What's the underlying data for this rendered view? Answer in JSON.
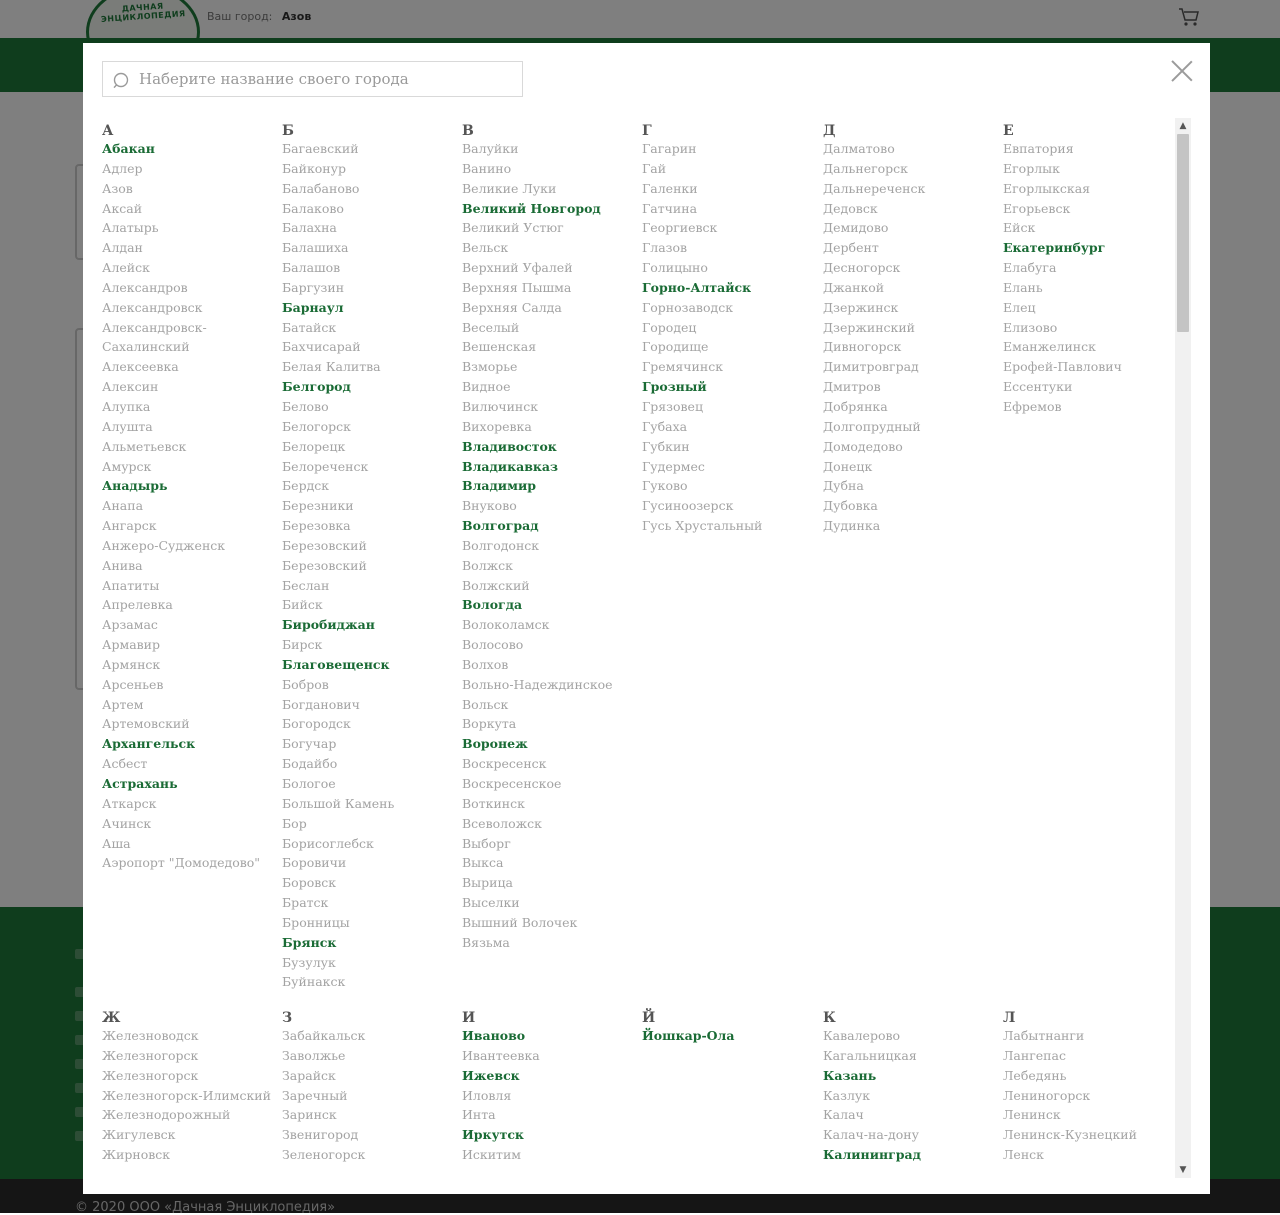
{
  "header": {
    "logo_text": "ДАЧНАЯ ЭНЦИКЛОПЕДИЯ",
    "city_label": "Ваш город:",
    "city_value": "Азов"
  },
  "footer": {
    "copyright": "© 2020 ООО «Дачная Энциклопедия»"
  },
  "modal": {
    "search_placeholder": "Наберите название своего города",
    "search_value": ""
  },
  "colors": {
    "brand_green": "#1f7a3a",
    "major_city": "#1a6b35",
    "city": "#a3a3a3"
  },
  "groups": [
    {
      "letter": "А",
      "cities": [
        {
          "name": "Абакан",
          "major": true
        },
        {
          "name": "Адлер"
        },
        {
          "name": "Азов"
        },
        {
          "name": "Аксай"
        },
        {
          "name": "Алатырь"
        },
        {
          "name": "Алдан"
        },
        {
          "name": "Алейск"
        },
        {
          "name": "Александров"
        },
        {
          "name": "Александровск"
        },
        {
          "name": "Александровск-"
        },
        {
          "name": "Сахалинский"
        },
        {
          "name": "Алексеевка"
        },
        {
          "name": "Алексин"
        },
        {
          "name": "Алупка"
        },
        {
          "name": "Алушта"
        },
        {
          "name": "Альметьевск"
        },
        {
          "name": "Амурск"
        },
        {
          "name": "Анадырь",
          "major": true
        },
        {
          "name": "Анапа"
        },
        {
          "name": "Ангарск"
        },
        {
          "name": "Анжеро-Судженск"
        },
        {
          "name": "Анива"
        },
        {
          "name": "Апатиты"
        },
        {
          "name": "Апрелевка"
        },
        {
          "name": "Арзамас"
        },
        {
          "name": "Армавир"
        },
        {
          "name": "Армянск"
        },
        {
          "name": "Арсеньев"
        },
        {
          "name": "Артем"
        },
        {
          "name": "Артемовский"
        },
        {
          "name": "Архангельск",
          "major": true
        },
        {
          "name": "Асбест"
        },
        {
          "name": "Астрахань",
          "major": true
        },
        {
          "name": "Аткарск"
        },
        {
          "name": "Ачинск"
        },
        {
          "name": "Аша"
        },
        {
          "name": "Аэропорт \"Домодедово\""
        }
      ]
    },
    {
      "letter": "Б",
      "cities": [
        {
          "name": "Багаевский"
        },
        {
          "name": "Байконур"
        },
        {
          "name": "Балабаново"
        },
        {
          "name": "Балаково"
        },
        {
          "name": "Балахна"
        },
        {
          "name": "Балашиха"
        },
        {
          "name": "Балашов"
        },
        {
          "name": "Баргузин"
        },
        {
          "name": "Барнаул",
          "major": true
        },
        {
          "name": "Батайск"
        },
        {
          "name": "Бахчисарай"
        },
        {
          "name": "Белая Калитва"
        },
        {
          "name": "Белгород",
          "major": true
        },
        {
          "name": "Белово"
        },
        {
          "name": "Белогорск"
        },
        {
          "name": "Белорецк"
        },
        {
          "name": "Белореченск"
        },
        {
          "name": "Бердск"
        },
        {
          "name": "Березники"
        },
        {
          "name": "Березовка"
        },
        {
          "name": "Березовский"
        },
        {
          "name": "Березовский"
        },
        {
          "name": "Беслан"
        },
        {
          "name": "Бийск"
        },
        {
          "name": "Биробиджан",
          "major": true
        },
        {
          "name": "Бирск"
        },
        {
          "name": "Благовещенск",
          "major": true
        },
        {
          "name": "Бобров"
        },
        {
          "name": "Богданович"
        },
        {
          "name": "Богородск"
        },
        {
          "name": "Богучар"
        },
        {
          "name": "Бодайбо"
        },
        {
          "name": "Бологое"
        },
        {
          "name": "Большой Камень"
        },
        {
          "name": "Бор"
        },
        {
          "name": "Борисоглебск"
        },
        {
          "name": "Боровичи"
        },
        {
          "name": "Боровск"
        },
        {
          "name": "Братск"
        },
        {
          "name": "Бронницы"
        },
        {
          "name": "Брянск",
          "major": true
        },
        {
          "name": "Бузулук"
        },
        {
          "name": "Буйнакск"
        }
      ]
    },
    {
      "letter": "В",
      "cities": [
        {
          "name": "Валуйки"
        },
        {
          "name": "Ванино"
        },
        {
          "name": "Великие Луки"
        },
        {
          "name": "Великий Новгород",
          "major": true
        },
        {
          "name": "Великий Устюг"
        },
        {
          "name": "Вельск"
        },
        {
          "name": "Верхний Уфалей"
        },
        {
          "name": "Верхняя Пышма"
        },
        {
          "name": "Верхняя Салда"
        },
        {
          "name": "Веселый"
        },
        {
          "name": "Вешенская"
        },
        {
          "name": "Взморье"
        },
        {
          "name": "Видное"
        },
        {
          "name": "Вилючинск"
        },
        {
          "name": "Вихоревка"
        },
        {
          "name": "Владивосток",
          "major": true
        },
        {
          "name": "Владикавказ",
          "major": true
        },
        {
          "name": "Владимир",
          "major": true
        },
        {
          "name": "Внуково"
        },
        {
          "name": "Волгоград",
          "major": true
        },
        {
          "name": "Волгодонск"
        },
        {
          "name": "Волжск"
        },
        {
          "name": "Волжский"
        },
        {
          "name": "Вологда",
          "major": true
        },
        {
          "name": "Волоколамск"
        },
        {
          "name": "Волосово"
        },
        {
          "name": "Волхов"
        },
        {
          "name": "Вольно-Надеждинское"
        },
        {
          "name": "Вольск"
        },
        {
          "name": "Воркута"
        },
        {
          "name": "Воронеж",
          "major": true
        },
        {
          "name": "Воскресенск"
        },
        {
          "name": "Воскресенское"
        },
        {
          "name": "Воткинск"
        },
        {
          "name": "Всеволожск"
        },
        {
          "name": "Выборг"
        },
        {
          "name": "Выкса"
        },
        {
          "name": "Вырица"
        },
        {
          "name": "Выселки"
        },
        {
          "name": "Вышний Волочек"
        },
        {
          "name": "Вязьма"
        }
      ]
    },
    {
      "letter": "Г",
      "cities": [
        {
          "name": "Гагарин"
        },
        {
          "name": "Гай"
        },
        {
          "name": "Галенки"
        },
        {
          "name": "Гатчина"
        },
        {
          "name": "Георгиевск"
        },
        {
          "name": "Глазов"
        },
        {
          "name": "Голицыно"
        },
        {
          "name": "Горно-Алтайск",
          "major": true
        },
        {
          "name": "Горнозаводск"
        },
        {
          "name": "Городец"
        },
        {
          "name": "Городище"
        },
        {
          "name": "Гремячинск"
        },
        {
          "name": "Грозный",
          "major": true
        },
        {
          "name": "Грязовец"
        },
        {
          "name": "Губаха"
        },
        {
          "name": "Губкин"
        },
        {
          "name": "Гудермес"
        },
        {
          "name": "Гуково"
        },
        {
          "name": "Гусиноозерск"
        },
        {
          "name": "Гусь Хрустальный"
        }
      ]
    },
    {
      "letter": "Д",
      "cities": [
        {
          "name": "Далматово"
        },
        {
          "name": "Дальнегорск"
        },
        {
          "name": "Дальнереченск"
        },
        {
          "name": "Дедовск"
        },
        {
          "name": "Демидово"
        },
        {
          "name": "Дербент"
        },
        {
          "name": "Десногорск"
        },
        {
          "name": "Джанкой"
        },
        {
          "name": "Дзержинск"
        },
        {
          "name": "Дзержинский"
        },
        {
          "name": "Дивногорск"
        },
        {
          "name": "Димитровград"
        },
        {
          "name": "Дмитров"
        },
        {
          "name": "Добрянка"
        },
        {
          "name": "Долгопрудный"
        },
        {
          "name": "Домодедово"
        },
        {
          "name": "Донецк"
        },
        {
          "name": "Дубна"
        },
        {
          "name": "Дубовка"
        },
        {
          "name": "Дудинка"
        }
      ]
    },
    {
      "letter": "Е",
      "cities": [
        {
          "name": "Евпатория"
        },
        {
          "name": "Егорлык"
        },
        {
          "name": "Егорлыкская"
        },
        {
          "name": "Егорьевск"
        },
        {
          "name": "Ейск"
        },
        {
          "name": "Екатеринбург",
          "major": true
        },
        {
          "name": "Елабуга"
        },
        {
          "name": "Елань"
        },
        {
          "name": "Елец"
        },
        {
          "name": "Елизово"
        },
        {
          "name": "Еманжелинск"
        },
        {
          "name": "Ерофей-Павлович"
        },
        {
          "name": "Ессентуки"
        },
        {
          "name": "Ефремов"
        }
      ]
    },
    {
      "letter": "Ж",
      "cities": [
        {
          "name": "Железноводск"
        },
        {
          "name": "Железногорск"
        },
        {
          "name": "Железногорск"
        },
        {
          "name": "Железногорск-Илимский"
        },
        {
          "name": "Железнодорожный"
        },
        {
          "name": "Жигулевск"
        },
        {
          "name": "Жирновск"
        }
      ]
    },
    {
      "letter": "З",
      "cities": [
        {
          "name": "Забайкальск"
        },
        {
          "name": "Заволжье"
        },
        {
          "name": "Зарайск"
        },
        {
          "name": "Заречный"
        },
        {
          "name": "Заринск"
        },
        {
          "name": "Звенигород"
        },
        {
          "name": "Зеленогорск"
        }
      ]
    },
    {
      "letter": "И",
      "cities": [
        {
          "name": "Иваново",
          "major": true
        },
        {
          "name": "Ивантеевка"
        },
        {
          "name": "Ижевск",
          "major": true
        },
        {
          "name": "Иловля"
        },
        {
          "name": "Инта"
        },
        {
          "name": "Иркутск",
          "major": true
        },
        {
          "name": "Искитим"
        }
      ]
    },
    {
      "letter": "Й",
      "cities": [
        {
          "name": "Йошкар-Ола",
          "major": true
        }
      ]
    },
    {
      "letter": "К",
      "cities": [
        {
          "name": "Кавалерово"
        },
        {
          "name": "Кагальницкая"
        },
        {
          "name": "Казань",
          "major": true
        },
        {
          "name": "Казлук"
        },
        {
          "name": "Калач"
        },
        {
          "name": "Калач-на-дону"
        },
        {
          "name": "Калининград",
          "major": true
        }
      ]
    },
    {
      "letter": "Л",
      "cities": [
        {
          "name": "Лабытнанги"
        },
        {
          "name": "Лангепас"
        },
        {
          "name": "Лебедянь"
        },
        {
          "name": "Лениногорск"
        },
        {
          "name": "Ленинск"
        },
        {
          "name": "Ленинск-Кузнецкий"
        },
        {
          "name": "Ленск"
        }
      ]
    }
  ]
}
